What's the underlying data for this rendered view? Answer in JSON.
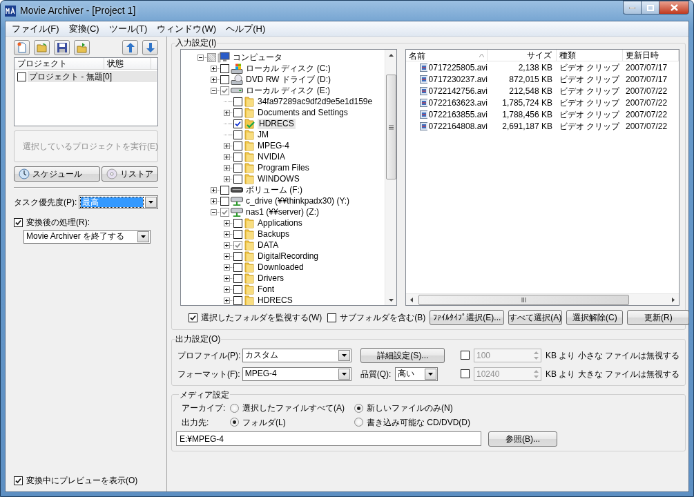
{
  "window": {
    "title": "Movie Archiver - [Project 1]"
  },
  "menu": [
    "ファイル(F)",
    "変換(C)",
    "ツール(T)",
    "ウィンドウ(W)",
    "ヘルプ(H)"
  ],
  "left": {
    "project_list": {
      "columns": [
        "プロジェクト",
        "状態"
      ],
      "rows": [
        {
          "name": "プロジェクト - 無題[0]",
          "checked": false,
          "selected": true
        }
      ]
    },
    "run_button": {
      "label": "選択しているプロジェクトを実行(E)",
      "disabled": true
    },
    "schedule_button": "スケジュール",
    "restore_button": "リストア",
    "priority": {
      "label": "タスク優先度(P):",
      "value": "最高",
      "highlighted": true
    },
    "after": {
      "label": "変換後の処理(R):",
      "checked": true,
      "value": "Movie Archiver を終了する"
    },
    "preview": {
      "label": "変換中にプレビューを表示(O)",
      "checked": true
    }
  },
  "input": {
    "title": "入力設定(I)",
    "tree": [
      {
        "label": "コンピュータ",
        "kind": "computer",
        "expandable": true,
        "expanded": true,
        "checked": false,
        "greyed": true,
        "selected": false,
        "children": [
          {
            "label": "ローカル ディスク (C:)",
            "kind": "system-drive",
            "expandable": true,
            "expanded": false,
            "checked": false,
            "greyed": false,
            "selected": false
          },
          {
            "label": "DVD RW ドライブ (D:)",
            "kind": "dvd",
            "expandable": true,
            "expanded": false,
            "checked": false,
            "greyed": false,
            "selected": false
          },
          {
            "label": "ローカル ディスク (E:)",
            "kind": "drive",
            "expandable": true,
            "expanded": true,
            "checked": true,
            "greyed": true,
            "selected": false,
            "children": [
              {
                "label": "34fa97289ac9df2d9e5e1d159e",
                "kind": "folder",
                "expandable": false,
                "expanded": false,
                "checked": false,
                "greyed": false,
                "selected": false
              },
              {
                "label": "Documents and Settings",
                "kind": "folder",
                "expandable": true,
                "expanded": false,
                "checked": false,
                "greyed": false,
                "selected": false
              },
              {
                "label": "HDRECS",
                "kind": "watched-folder",
                "expandable": false,
                "expanded": false,
                "checked": true,
                "greyed": false,
                "selected": true
              },
              {
                "label": "JM",
                "kind": "folder",
                "expandable": false,
                "expanded": false,
                "checked": false,
                "greyed": false,
                "selected": false
              },
              {
                "label": "MPEG-4",
                "kind": "folder",
                "expandable": true,
                "expanded": false,
                "checked": false,
                "greyed": false,
                "selected": false
              },
              {
                "label": "NVIDIA",
                "kind": "folder",
                "expandable": true,
                "expanded": false,
                "checked": false,
                "greyed": false,
                "selected": false
              },
              {
                "label": "Program Files",
                "kind": "folder",
                "expandable": true,
                "expanded": false,
                "checked": false,
                "greyed": false,
                "selected": false
              },
              {
                "label": "WINDOWS",
                "kind": "folder",
                "expandable": true,
                "expanded": false,
                "checked": false,
                "greyed": false,
                "selected": false
              }
            ]
          },
          {
            "label": "ボリューム (F:)",
            "kind": "removable",
            "expandable": true,
            "expanded": false,
            "checked": false,
            "greyed": false,
            "selected": false
          },
          {
            "label": "c_drive (¥¥thinkpadx30) (Y:)",
            "kind": "network",
            "expandable": true,
            "expanded": false,
            "checked": false,
            "greyed": false,
            "selected": false
          },
          {
            "label": "nas1 (¥¥server) (Z:)",
            "kind": "network",
            "expandable": true,
            "expanded": true,
            "checked": true,
            "greyed": true,
            "selected": false,
            "children": [
              {
                "label": "Applications",
                "kind": "folder",
                "expandable": true,
                "expanded": false,
                "checked": false,
                "greyed": false,
                "selected": false
              },
              {
                "label": "Backups",
                "kind": "folder",
                "expandable": true,
                "expanded": false,
                "checked": false,
                "greyed": false,
                "selected": false
              },
              {
                "label": "DATA",
                "kind": "folder",
                "expandable": true,
                "expanded": false,
                "checked": true,
                "greyed": true,
                "selected": false
              },
              {
                "label": "DigitalRecording",
                "kind": "folder",
                "expandable": true,
                "expanded": false,
                "checked": false,
                "greyed": false,
                "selected": false
              },
              {
                "label": "Downloaded",
                "kind": "folder",
                "expandable": true,
                "expanded": false,
                "checked": false,
                "greyed": false,
                "selected": false
              },
              {
                "label": "Drivers",
                "kind": "folder",
                "expandable": true,
                "expanded": false,
                "checked": false,
                "greyed": false,
                "selected": false
              },
              {
                "label": "Font",
                "kind": "folder",
                "expandable": true,
                "expanded": false,
                "checked": false,
                "greyed": false,
                "selected": false
              },
              {
                "label": "HDRECS",
                "kind": "folder",
                "expandable": true,
                "expanded": false,
                "checked": false,
                "greyed": false,
                "selected": false
              }
            ]
          }
        ]
      }
    ],
    "files": {
      "columns": [
        "名前",
        "サイズ",
        "種類",
        "更新日時"
      ],
      "rows": [
        [
          "0717225805.avi",
          "2,138 KB",
          "ビデオ クリップ",
          "2007/07/17"
        ],
        [
          "0717230237.avi",
          "872,015 KB",
          "ビデオ クリップ",
          "2007/07/17"
        ],
        [
          "0722142756.avi",
          "212,548 KB",
          "ビデオ クリップ",
          "2007/07/22"
        ],
        [
          "0722163623.avi",
          "1,785,724 KB",
          "ビデオ クリップ",
          "2007/07/22"
        ],
        [
          "0722163855.avi",
          "1,788,456 KB",
          "ビデオ クリップ",
          "2007/07/22"
        ],
        [
          "0722164808.avi",
          "2,691,187 KB",
          "ビデオ クリップ",
          "2007/07/22"
        ]
      ]
    },
    "watch": {
      "label": "選択したフォルダを監視する(W)",
      "checked": true
    },
    "subfolders": {
      "label": "サブフォルダを含む(B)",
      "checked": false
    },
    "buttons": [
      "ﾌｧｲﾙﾀｲﾌﾟ選択(E)...",
      "すべて選択(A)",
      "選択解除(C)",
      "更新(R)"
    ]
  },
  "output": {
    "title": "出力設定(O)",
    "profile": {
      "label": "プロファイル(P):",
      "value": "カスタム"
    },
    "detail_button": "詳細設定(S)...",
    "format": {
      "label": "フォーマット(F):",
      "value": "MPEG-4"
    },
    "quality": {
      "label": "品質(Q):",
      "value": "高い"
    },
    "min": {
      "checked": false,
      "value": "100",
      "disabled": true,
      "text": "KB より 小さな ファイルは無視する"
    },
    "max": {
      "checked": false,
      "value": "10240",
      "disabled": true,
      "text": "KB より 大きな ファイルは無視する"
    }
  },
  "media": {
    "title": "メディア設定",
    "archive": {
      "label": "アーカイブ:",
      "options": [
        {
          "label": "選択したファイルすべて(A)",
          "selected": false
        },
        {
          "label": "新しいファイルのみ(N)",
          "selected": true
        }
      ]
    },
    "destination": {
      "label": "出力先:",
      "options": [
        {
          "label": "フォルダ(L)",
          "selected": true
        },
        {
          "label": "書き込み可能な CD/DVD(D)",
          "selected": false
        }
      ]
    },
    "path": "E:¥MPEG-4",
    "browse_button": "参照(B)..."
  }
}
